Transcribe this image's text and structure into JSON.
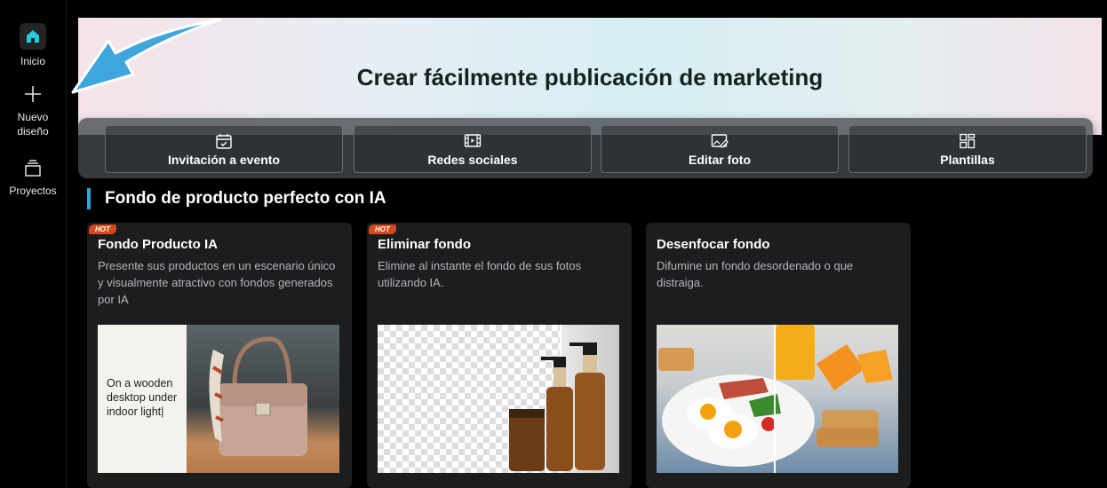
{
  "sidebar": {
    "items": [
      {
        "label": "Inicio",
        "icon": "home-icon",
        "active": true
      },
      {
        "label": "Nuevo diseño",
        "icon": "plus-icon"
      },
      {
        "label": "Proyectos",
        "icon": "stack-icon"
      }
    ]
  },
  "hero": {
    "title": "Crear fácilmente publicación de marketing"
  },
  "quick_actions": [
    {
      "label": "Invitación a evento",
      "icon": "calendar-check-icon"
    },
    {
      "label": "Redes sociales",
      "icon": "video-film-icon"
    },
    {
      "label": "Editar foto",
      "icon": "image-edit-icon"
    },
    {
      "label": "Plantillas",
      "icon": "grid-icon"
    }
  ],
  "section": {
    "title": "Fondo de producto perfecto con IA"
  },
  "cards": [
    {
      "badge": "HOT",
      "title": "Fondo Producto IA",
      "desc": "Presente sus productos en un escenario único y visualmente atractivo con fondos generados por IA",
      "image_text": "On a wooden desktop under indoor light|"
    },
    {
      "badge": "HOT",
      "title": "Eliminar fondo",
      "desc": "Elimine al instante el fondo de sus fotos utilizando IA."
    },
    {
      "title": "Desenfocar fondo",
      "desc": "Difumine un fondo desordenado o que distraiga."
    }
  ],
  "colors": {
    "accent": "#2fa8d6",
    "hot_badge": "#d24a1d",
    "home_icon": "#25c7e3",
    "arrow": "#3ea6dc"
  }
}
